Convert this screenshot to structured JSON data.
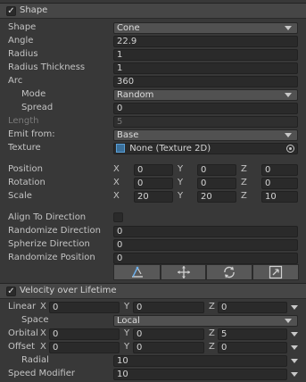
{
  "shape_section": {
    "title": "Shape",
    "enabled": true,
    "shape": {
      "label": "Shape",
      "value": "Cone"
    },
    "angle": {
      "label": "Angle",
      "value": "22.9"
    },
    "radius": {
      "label": "Radius",
      "value": "1"
    },
    "radius_thickness": {
      "label": "Radius Thickness",
      "value": "1"
    },
    "arc": {
      "label": "Arc",
      "value": "360"
    },
    "mode": {
      "label": "Mode",
      "value": "Random"
    },
    "spread": {
      "label": "Spread",
      "value": "0"
    },
    "length": {
      "label": "Length",
      "value": "5"
    },
    "emit_from": {
      "label": "Emit from:",
      "value": "Base"
    },
    "texture": {
      "label": "Texture",
      "value": "None (Texture 2D)"
    },
    "position": {
      "label": "Position",
      "x": "0",
      "y": "0",
      "z": "0"
    },
    "rotation": {
      "label": "Rotation",
      "x": "0",
      "y": "0",
      "z": "0"
    },
    "scale": {
      "label": "Scale",
      "x": "20",
      "y": "20",
      "z": "10"
    },
    "axis_labels": {
      "x": "X",
      "y": "Y",
      "z": "Z"
    },
    "align_to_direction": {
      "label": "Align To Direction",
      "checked": false
    },
    "randomize_direction": {
      "label": "Randomize Direction",
      "value": "0"
    },
    "spherize_direction": {
      "label": "Spherize Direction",
      "value": "0"
    },
    "randomize_position": {
      "label": "Randomize Position",
      "value": "0"
    }
  },
  "velocity_section": {
    "title": "Velocity over Lifetime",
    "enabled": true,
    "linear": {
      "label": "Linear",
      "x": "0",
      "y": "0",
      "z": "0"
    },
    "space": {
      "label": "Space",
      "value": "Local"
    },
    "orbital": {
      "label": "Orbital",
      "x": "0",
      "y": "0",
      "z": "5"
    },
    "offset": {
      "label": "Offset",
      "x": "0",
      "y": "0",
      "z": "0"
    },
    "radial": {
      "label": "Radial",
      "value": "10"
    },
    "speed_modifier": {
      "label": "Speed Modifier",
      "value": "10"
    }
  },
  "colors": {
    "background": "#383838",
    "header": "#464646",
    "field": "#2a2a2a",
    "popup": "#515151"
  }
}
